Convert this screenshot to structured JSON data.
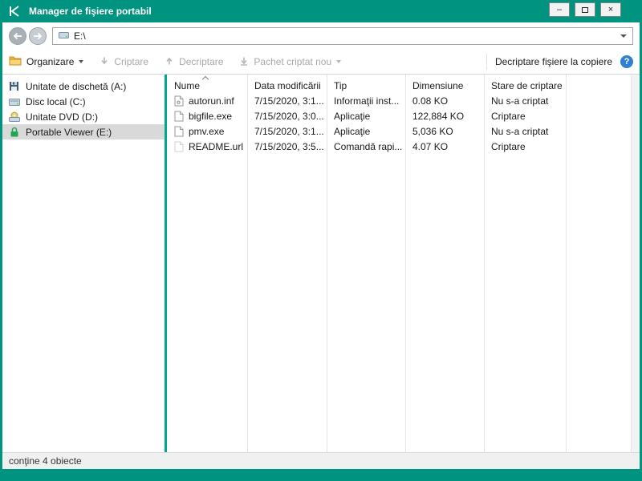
{
  "window": {
    "title": "Manager de fişiere portabil",
    "controls": {
      "minimize": "–",
      "close": "×"
    }
  },
  "navigation": {
    "address_path": "E:\\"
  },
  "toolbar": {
    "buttons": [
      {
        "label": "Organizare",
        "icon": "folder-icon",
        "enabled": true,
        "has_dropdown": true
      },
      {
        "label": "Criptare",
        "icon": "encrypt-arrow-icon",
        "enabled": false,
        "has_dropdown": false
      },
      {
        "label": "Decriptare",
        "icon": "decrypt-arrow-icon",
        "enabled": false,
        "has_dropdown": false
      },
      {
        "label": "Pachet criptat nou",
        "icon": "new-encrypted-package-icon",
        "enabled": false,
        "has_dropdown": true
      }
    ],
    "decrypt_on_copy_label": "Decriptare fişiere la copiere",
    "help_glyph": "?"
  },
  "sidebar": {
    "items": [
      {
        "label": "Unitate de dischetă (A:)",
        "icon": "floppy-drive-icon",
        "selected": false
      },
      {
        "label": "Disc local (C:)",
        "icon": "hard-drive-icon",
        "selected": false
      },
      {
        "label": "Unitate DVD (D:)",
        "icon": "dvd-drive-icon",
        "selected": false
      },
      {
        "label": "Portable Viewer (E:)",
        "icon": "encrypted-drive-lock-icon",
        "selected": true
      }
    ]
  },
  "file_list": {
    "columns": [
      "Nume",
      "Data modificării",
      "Tip",
      "Dimensiune",
      "Stare de criptare"
    ],
    "sort": {
      "column": "Nume",
      "direction": "asc"
    },
    "rows": [
      {
        "icon": "inf-file-icon",
        "name": "autorun.inf",
        "date": "7/15/2020, 3:1...",
        "type": "Informaţii inst...",
        "size": "0.08 KO",
        "status": "Nu s-a criptat"
      },
      {
        "icon": "exe-file-icon",
        "name": "bigfile.exe",
        "date": "7/15/2020, 3:0...",
        "type": "Aplicaţie",
        "size": "122,884 KO",
        "status": "Criptare"
      },
      {
        "icon": "exe-file-icon",
        "name": "pmv.exe",
        "date": "7/15/2020, 3:1...",
        "type": "Aplicaţie",
        "size": "5,036 KO",
        "status": "Nu s-a criptat"
      },
      {
        "icon": "url-file-icon",
        "name": "README.url",
        "date": "7/15/2020, 3:5...",
        "type": "Comandă rapi...",
        "size": "4.07 KO",
        "status": "Criptare"
      }
    ]
  },
  "status_bar": {
    "text": "conţine 4 obiecte"
  },
  "colors": {
    "titlebar_green": "#009480",
    "separator_teal": "#00a88e",
    "selection_gray": "#d9d9d9",
    "help_blue": "#2f80d0",
    "disabled_text": "#a8a8a8"
  }
}
